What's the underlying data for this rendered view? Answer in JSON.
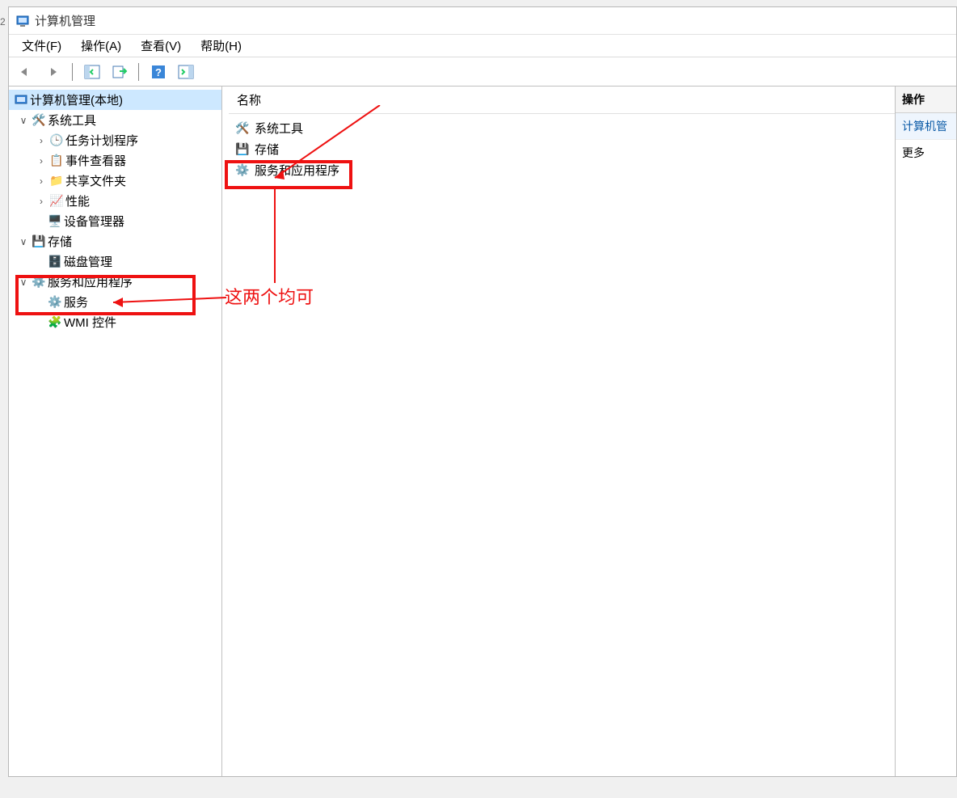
{
  "window": {
    "title": "计算机管理"
  },
  "menubar": {
    "file": "文件(F)",
    "action": "操作(A)",
    "view": "查看(V)",
    "help": "帮助(H)"
  },
  "tree": {
    "root": "计算机管理(本地)",
    "system_tools": "系统工具",
    "task_scheduler": "任务计划程序",
    "event_viewer": "事件查看器",
    "shared_folders": "共享文件夹",
    "performance": "性能",
    "device_manager": "设备管理器",
    "storage": "存储",
    "disk_management": "磁盘管理",
    "services_apps": "服务和应用程序",
    "services": "服务",
    "wmi_control": "WMI 控件"
  },
  "list": {
    "header_name": "名称",
    "items": {
      "system_tools": "系统工具",
      "storage": "存储",
      "services_apps": "服务和应用程序"
    }
  },
  "actions": {
    "header": "操作",
    "context": "计算机管",
    "more": "更多"
  },
  "annotation": {
    "label": "这两个均可"
  },
  "gutter": {
    "top": "2"
  }
}
